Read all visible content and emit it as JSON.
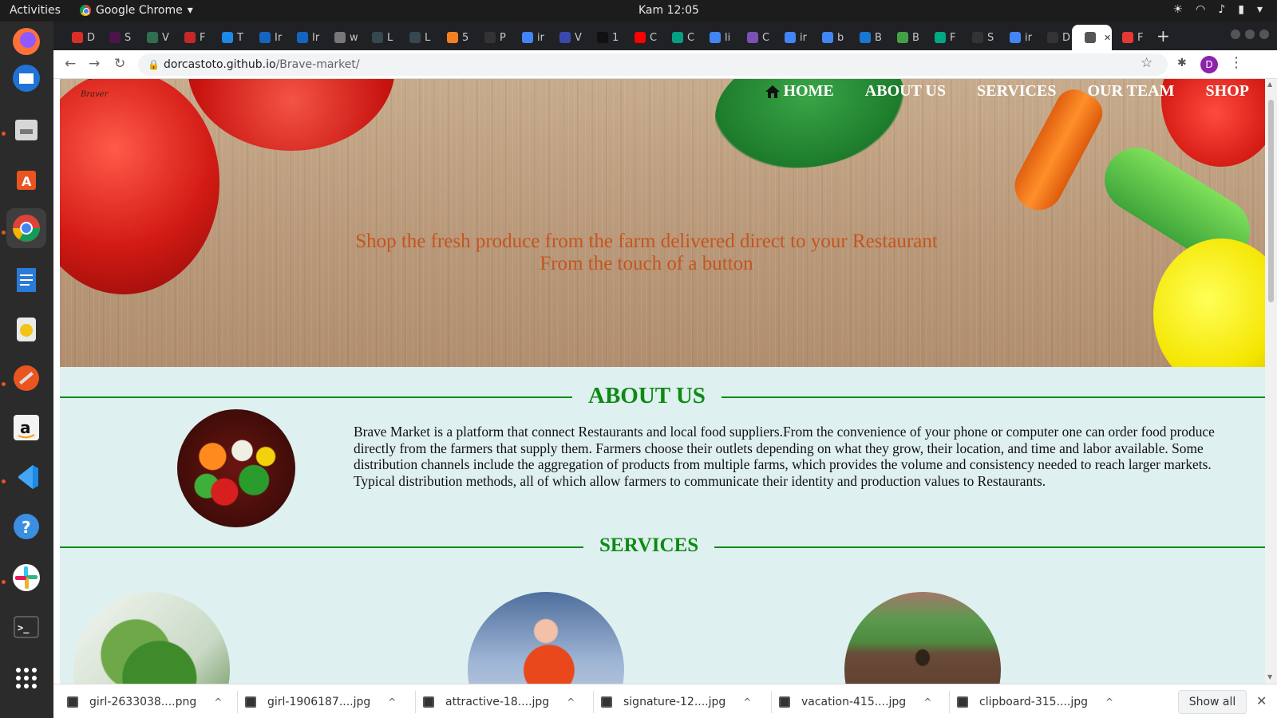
{
  "system": {
    "activities": "Activities",
    "app_name": "Google Chrome",
    "clock": "Kam 12:05"
  },
  "browser": {
    "tabs": [
      {
        "icon": "gmail-icon",
        "label": "D",
        "color": "#d93025"
      },
      {
        "icon": "slack-icon",
        "label": "S",
        "color": "#4a154b"
      },
      {
        "icon": "vue-icon",
        "label": "V",
        "color": "#2f6f4f"
      },
      {
        "icon": "app-icon",
        "label": "F",
        "color": "#c62828"
      },
      {
        "icon": "react-icon",
        "label": "T",
        "color": "#1e88e5"
      },
      {
        "icon": "codewars-icon",
        "label": "Ir",
        "color": "#1565c0"
      },
      {
        "icon": "codewars-icon",
        "label": "Ir",
        "color": "#1565c0"
      },
      {
        "icon": "globe-icon",
        "label": "w",
        "color": "#777777"
      },
      {
        "icon": "doc-icon",
        "label": "L",
        "color": "#37474f"
      },
      {
        "icon": "doc-icon",
        "label": "L",
        "color": "#37474f"
      },
      {
        "icon": "stack-icon",
        "label": "5",
        "color": "#f48024"
      },
      {
        "icon": "github-icon",
        "label": "P",
        "color": "#333333"
      },
      {
        "icon": "google-icon",
        "label": "ir",
        "color": "#4285f4"
      },
      {
        "icon": "app-icon",
        "label": "V",
        "color": "#3949ab"
      },
      {
        "icon": "wix-icon",
        "label": "1",
        "color": "#111111"
      },
      {
        "icon": "youtube-icon",
        "label": "C",
        "color": "#ff0000"
      },
      {
        "icon": "px-icon",
        "label": "C",
        "color": "#05a081"
      },
      {
        "icon": "google-icon",
        "label": "li",
        "color": "#4285f4"
      },
      {
        "icon": "bootstrap-icon",
        "label": "C",
        "color": "#7952b3"
      },
      {
        "icon": "google-icon",
        "label": "ir",
        "color": "#4285f4"
      },
      {
        "icon": "google-icon",
        "label": "b",
        "color": "#4285f4"
      },
      {
        "icon": "app-icon",
        "label": "B",
        "color": "#1976d2"
      },
      {
        "icon": "app-icon",
        "label": "B",
        "color": "#43a047"
      },
      {
        "icon": "shield-icon",
        "label": "F",
        "color": "#00a884"
      },
      {
        "icon": "github-icon",
        "label": "S",
        "color": "#333333"
      },
      {
        "icon": "google-icon",
        "label": "ir",
        "color": "#4285f4"
      },
      {
        "icon": "github-icon",
        "label": "D",
        "color": "#333333"
      },
      {
        "icon": "globe-icon",
        "label": "",
        "color": "#555555",
        "active": true
      },
      {
        "icon": "app-icon",
        "label": "F",
        "color": "#e53935"
      }
    ],
    "url_host": "dorcastoto.github.io",
    "url_path": "/Brave-market/",
    "profile_initial": "D"
  },
  "site": {
    "logo_text": "Braver",
    "nav": [
      "HOME",
      "ABOUT US",
      "SERVICES",
      "OUR TEAM",
      "SHOP"
    ],
    "tagline_line1": "Shop the fresh produce from the farm delivered direct to your Restaurant",
    "tagline_line2": "From the touch of a button",
    "about_heading": "ABOUT US",
    "about_text": "Brave Market is a platform that connect Restaurants and local food suppliers.From the convenience of your phone or computer one can order food produce directly from the farmers that supply them. Farmers choose their outlets depending on what they grow, their location, and time and labor available. Some distribution channels include the aggregation of products from multiple farms, which provides the volume and consistency needed to reach larger markets. Typical distribution methods, all of which allow farmers to communicate their identity and production values to Restaurants.",
    "services_heading": "SERVICES"
  },
  "downloads": {
    "items": [
      "girl-2633038....png",
      "girl-1906187....jpg",
      "attractive-18....jpg",
      "signature-12....jpg",
      "vacation-415....jpg",
      "clipboard-315....jpg"
    ],
    "show_all": "Show all"
  },
  "colors": {
    "accent_green": "#0e8a14",
    "tagline": "#c6541f",
    "section_bg": "#def0ef"
  }
}
